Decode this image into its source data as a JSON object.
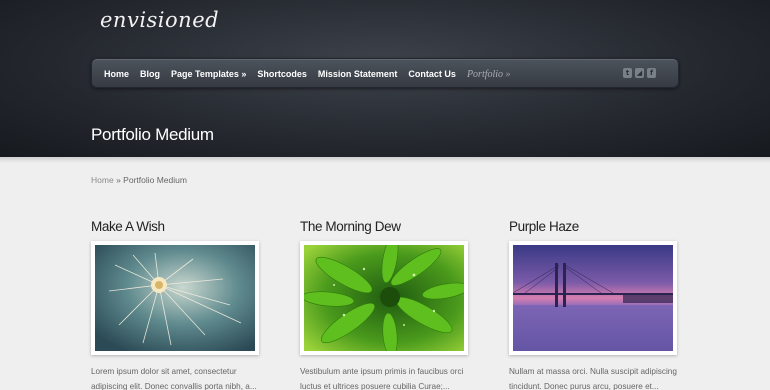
{
  "site": {
    "logo": "envisioned"
  },
  "nav": {
    "items": [
      {
        "label": "Home"
      },
      {
        "label": "Blog"
      },
      {
        "label": "Page Templates »"
      },
      {
        "label": "Shortcodes"
      },
      {
        "label": "Mission Statement"
      },
      {
        "label": "Contact Us"
      }
    ],
    "current": "Portfolio »",
    "social": [
      {
        "icon": "twitter-icon",
        "glyph": "t"
      },
      {
        "icon": "rss-icon",
        "glyph": "◢"
      },
      {
        "icon": "facebook-icon",
        "glyph": "f"
      }
    ]
  },
  "page": {
    "title": "Portfolio Medium"
  },
  "breadcrumb": {
    "home": "Home",
    "separator": "»",
    "current": "Portfolio Medium"
  },
  "portfolio": [
    {
      "title": "Make A Wish",
      "image": "dandelion-image",
      "excerpt": "Lorem ipsum dolor sit amet, consectetur adipiscing elit. Donec convallis porta nibh, a..."
    },
    {
      "title": "The Morning Dew",
      "image": "leaf-image",
      "excerpt": "Vestibulum ante ipsum primis in faucibus orci luctus et ultrices posuere cubilia Curae;..."
    },
    {
      "title": "Purple Haze",
      "image": "bridge-image",
      "excerpt": "Nullam at massa orci. Nulla suscipit adipiscing tincidunt. Donec purus arcu, posuere et..."
    }
  ]
}
